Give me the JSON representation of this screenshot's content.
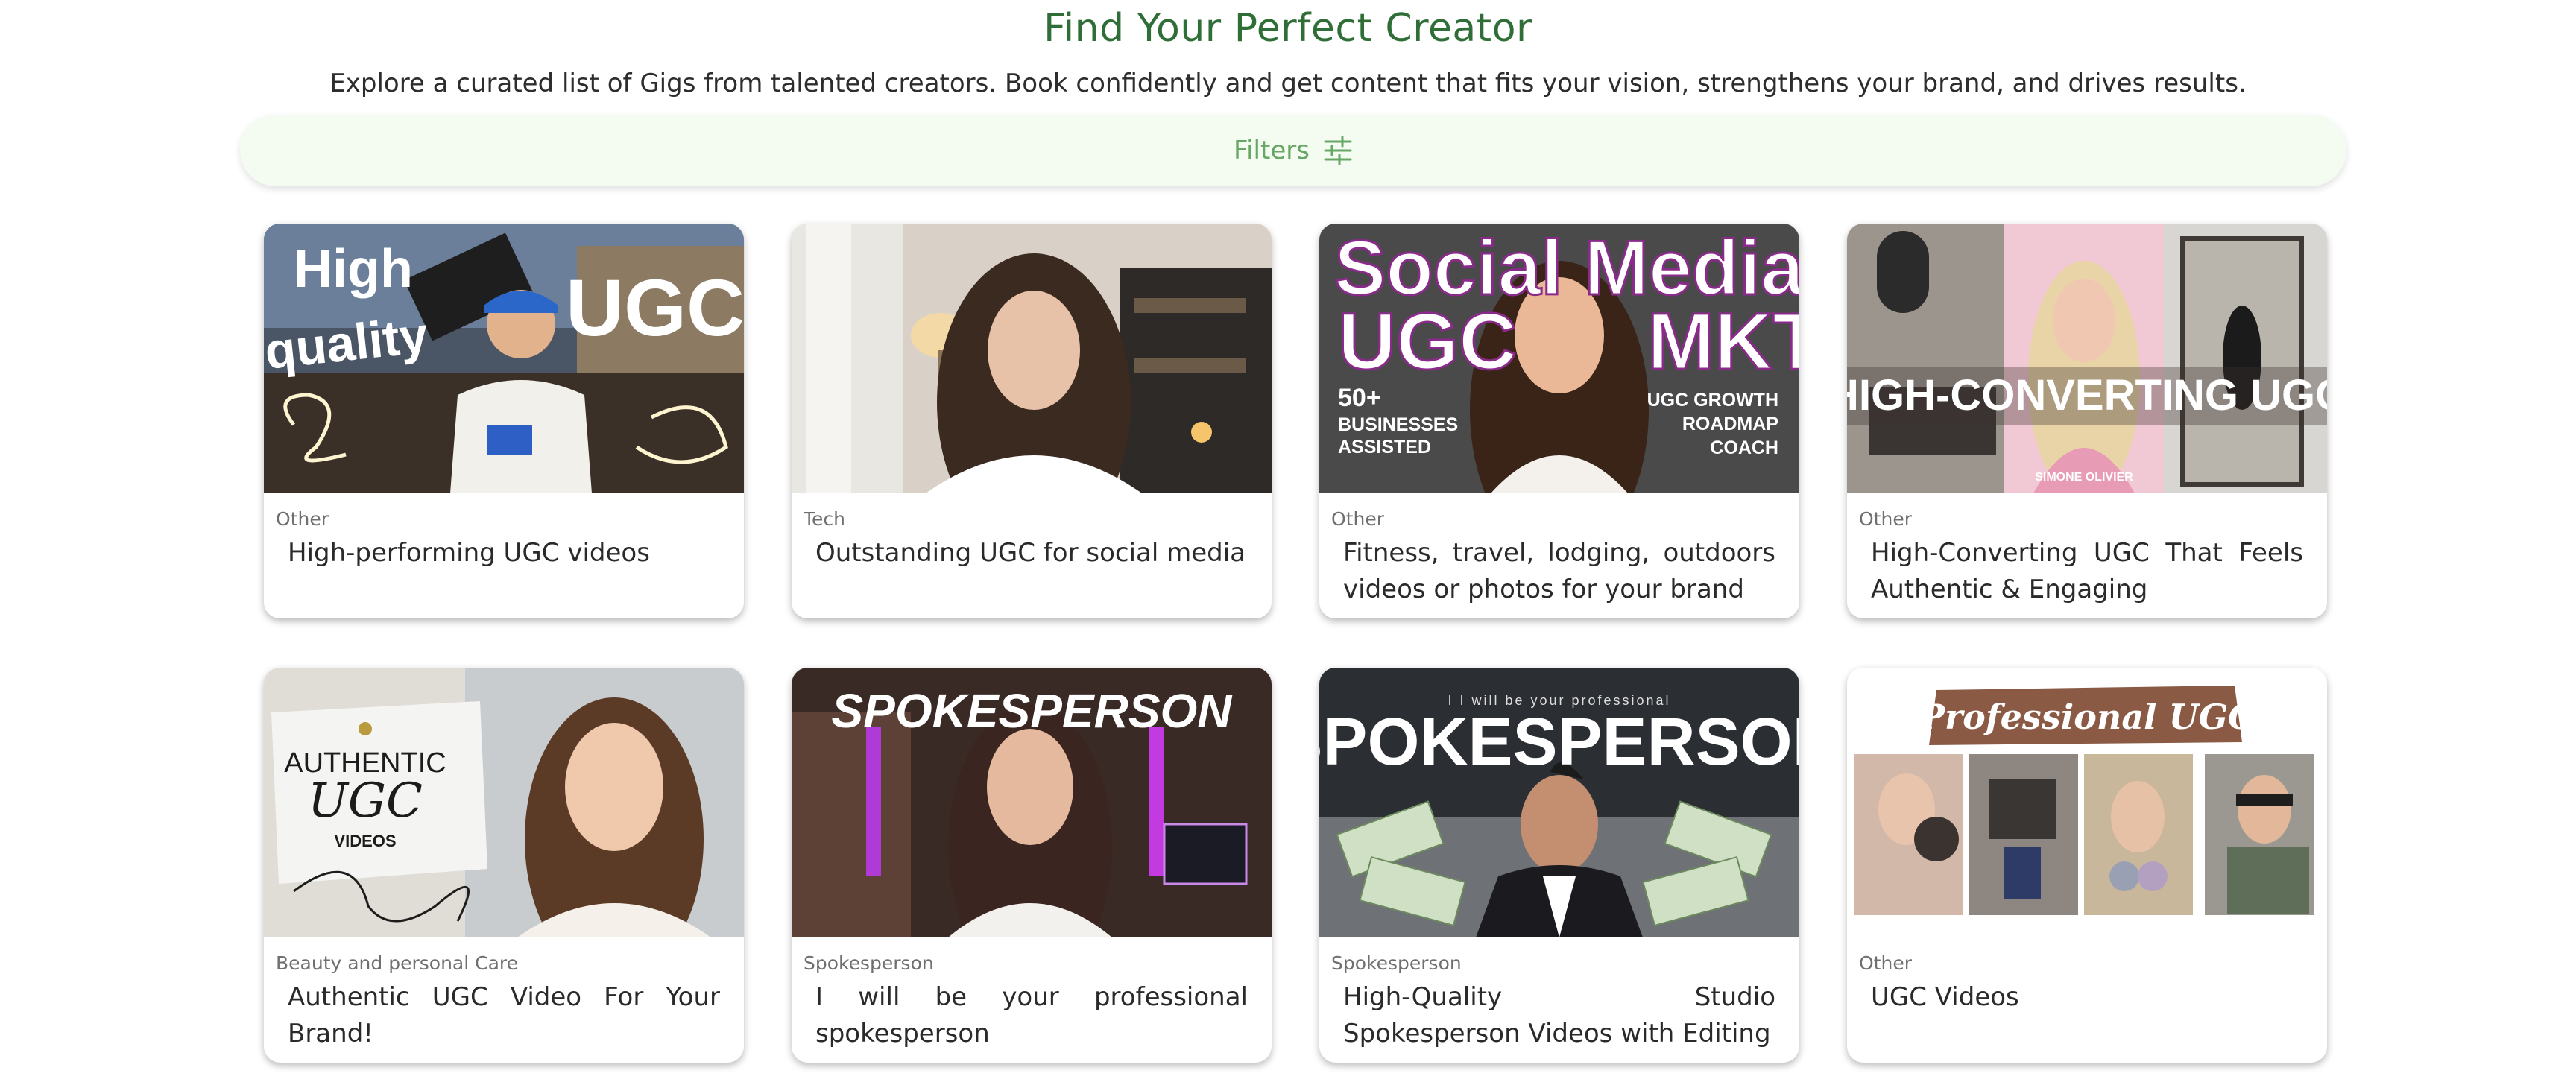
{
  "header": {
    "title": "Find Your Perfect Creator",
    "subtitle": "Explore a curated list of Gigs from talented creators. Book confidently and get content that fits your vision, strengthens your brand, and drives results."
  },
  "filters": {
    "label": "Filters",
    "icon": "sliders-icon"
  },
  "colors": {
    "title": "#2f6e36",
    "filter_text": "#66a763",
    "filter_bg": "#f4fbf1"
  },
  "gigs": [
    {
      "category": "Other",
      "title": "High-performing UGC videos",
      "thumb_text": [
        "High",
        "quality",
        "UGC"
      ],
      "thumb_description": "young man in blue cap holding Fanta can"
    },
    {
      "category": "Tech",
      "title": "Outstanding UGC for social media",
      "thumb_description": "woman with long brown hair in living room"
    },
    {
      "category": "Other",
      "title": "Fitness, travel, lodging, outdoors videos or photos for your brand",
      "thumb_text": [
        "Social Media",
        "UGC",
        "MKT",
        "50+",
        "BUSINESSES",
        "ASSISTED",
        "UGC GROWTH",
        "ROADMAP",
        "COACH"
      ]
    },
    {
      "category": "Other",
      "title": "High-Converting UGC That Feels Authentic & Engaging",
      "thumb_text": [
        "HIGH-CONVERTING UGC",
        "SIMONE OLIVIER"
      ]
    },
    {
      "category": "Beauty and personal Care",
      "title": "Authentic UGC Video For Your Brand!",
      "thumb_text": [
        "AUTHENTIC",
        "UGC",
        "VIDEOS"
      ]
    },
    {
      "category": "Spokesperson",
      "title": "I will be your professional spokesperson",
      "thumb_text": [
        "SPOKESPERSON"
      ]
    },
    {
      "category": "Spokesperson",
      "title": "High-Quality Studio Spokesperson Videos with Editing",
      "thumb_text": [
        "I I will be your professional",
        "SPOKESPERSON"
      ]
    },
    {
      "category": "Other",
      "title": "UGC Videos",
      "thumb_text": [
        "Professional UGC"
      ]
    }
  ]
}
